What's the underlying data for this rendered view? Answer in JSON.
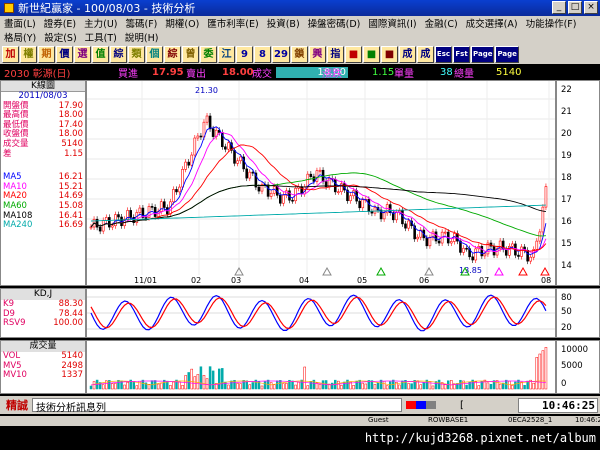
{
  "window": {
    "title": "新世紀贏家 - 100/08/03 - 技術分析"
  },
  "menu": {
    "row1": [
      "畫面(L)",
      "證券(E)",
      "主力(U)",
      "籌碼(F)",
      "期權(O)",
      "匯市利率(E)",
      "投資(B)",
      "操盤密碼(D)",
      "國際資訊(I)",
      "金融(C)",
      "成交選擇(A)",
      "功能操作(F)"
    ],
    "row2": [
      "格局(Y)",
      "設定(S)",
      "工具(T)",
      "說明(H)"
    ]
  },
  "toolbar": {
    "buttons": [
      "加",
      "權",
      "期",
      "價",
      "選",
      "值",
      "綜",
      "類",
      "個",
      "綜",
      "曾",
      "委",
      "江",
      "9",
      "8",
      "29",
      "鎖",
      "興",
      "指",
      "■",
      "■",
      "■",
      "成",
      "成",
      "Esc",
      "Fst",
      "Page",
      "Page"
    ]
  },
  "quote": {
    "symbol": "2030 彰源(日)",
    "buy_label": "買進",
    "buy_value": "17.95",
    "sell_label": "賣出",
    "sell_value": "18.00",
    "deal_label": "成交",
    "deal_value": "18.00",
    "change_label": "漲跌",
    "change_value": "1.15",
    "lots_label": "單量",
    "lots_value": "38",
    "total_label": "總量",
    "total_value": "5140"
  },
  "kline_panel": {
    "title": "K線圖",
    "date": "2011/08/03",
    "rows": [
      {
        "label": "開盤價",
        "value": "17.90"
      },
      {
        "label": "最高價",
        "value": "18.00"
      },
      {
        "label": "最低價",
        "value": "17.40"
      },
      {
        "label": "收盤價",
        "value": "18.00"
      },
      {
        "label": "成交量",
        "value": "5140"
      },
      {
        "label": "差",
        "value": "1.15"
      }
    ],
    "ma": [
      {
        "label": "MA5",
        "value": "16.21",
        "color": "#0000ff"
      },
      {
        "label": "MA10",
        "value": "15.21",
        "color": "#ff00ff"
      },
      {
        "label": "MA20",
        "value": "14.69",
        "color": "#ff0000"
      },
      {
        "label": "MA60",
        "value": "15.08",
        "color": "#00aa00"
      },
      {
        "label": "MA108",
        "value": "16.41",
        "color": "#000000"
      },
      {
        "label": "MA240",
        "value": "16.69",
        "color": "#00aaaa"
      }
    ]
  },
  "kd_panel": {
    "title": "KD,J",
    "rows": [
      {
        "label": "K9",
        "value": "88.30"
      },
      {
        "label": "D9",
        "value": "78.44"
      },
      {
        "label": "RSV9",
        "value": "100.00"
      }
    ]
  },
  "vol_panel": {
    "title": "成交量",
    "rows": [
      {
        "label": "VOL",
        "value": "5140"
      },
      {
        "label": "MV5",
        "value": "2498"
      },
      {
        "label": "MV10",
        "value": "1337"
      }
    ]
  },
  "axis_price": [
    "22",
    "21",
    "20",
    "19",
    "18",
    "17",
    "16",
    "15",
    "14"
  ],
  "axis_kd": [
    "80",
    "50",
    "20"
  ],
  "axis_vol": [
    "10000",
    "5000",
    "0"
  ],
  "months": [
    "11/01",
    "02",
    "03",
    "04",
    "05",
    "06",
    "07",
    "08"
  ],
  "annotations": {
    "high": "21.30",
    "low": "13.85"
  },
  "status": {
    "left1": "精誠",
    "left2": "技術分析訊息列",
    "time": "10:46:25"
  },
  "bottom": {
    "user": "Guest",
    "server": "ROWBASE1",
    "code": "0ECA2528_1",
    "time": "10:46:25"
  },
  "url": "http://kujd3268.pixnet.net/album",
  "chart_data": {
    "type": "line",
    "x": [
      "2010-12",
      "2011-01",
      "2011-02",
      "2011-03",
      "2011-04",
      "2011-05",
      "2011-06",
      "2011-07",
      "2011-08"
    ],
    "series": [
      {
        "name": "MA5",
        "values": [
          16.0,
          16.8,
          20.5,
          18.2,
          18.2,
          17.5,
          15.2,
          14.3,
          16.2
        ]
      },
      {
        "name": "MA60",
        "values": [
          16.4,
          17.0,
          18.0,
          18.2,
          18.6,
          18.5,
          17.8,
          15.5,
          15.1
        ]
      },
      {
        "name": "MA240",
        "values": [
          15.8,
          15.9,
          16.1,
          16.3,
          16.4,
          16.5,
          16.6,
          16.6,
          16.7
        ]
      }
    ],
    "ylim": [
      13.5,
      22.5
    ]
  }
}
